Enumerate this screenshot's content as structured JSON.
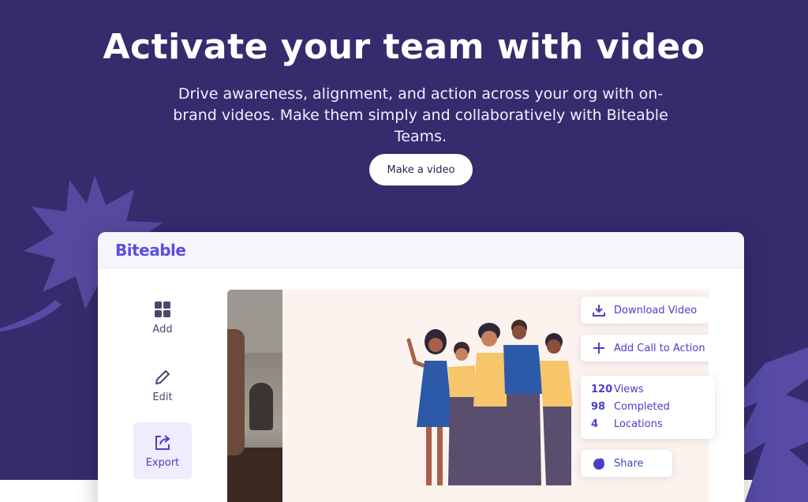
{
  "hero": {
    "title": "Activate your team with video",
    "subtitle": "Drive awareness, alignment, and action across your org with on-brand videos. Make them simply and collaboratively with Biteable Teams.",
    "cta_label": "Make a video"
  },
  "app": {
    "brand": "Biteable",
    "tools": [
      {
        "label": "Add",
        "icon": "grid-icon"
      },
      {
        "label": "Edit",
        "icon": "pencil-icon"
      },
      {
        "label": "Export",
        "icon": "export-icon",
        "active": true
      }
    ],
    "actions": {
      "download_label": "Download Video",
      "call_to_action_label": "Add Call to Action",
      "share_label": "Share"
    },
    "stats": [
      {
        "value": "120",
        "label": "Views"
      },
      {
        "value": "98",
        "label": "Completed"
      },
      {
        "value": "4",
        "label": "Locations"
      }
    ]
  },
  "colors": {
    "background": "#352c6e",
    "accent": "#5b4ee0",
    "active_tool_bg": "#efedfd",
    "preview_bg": "#fdf3ee"
  }
}
